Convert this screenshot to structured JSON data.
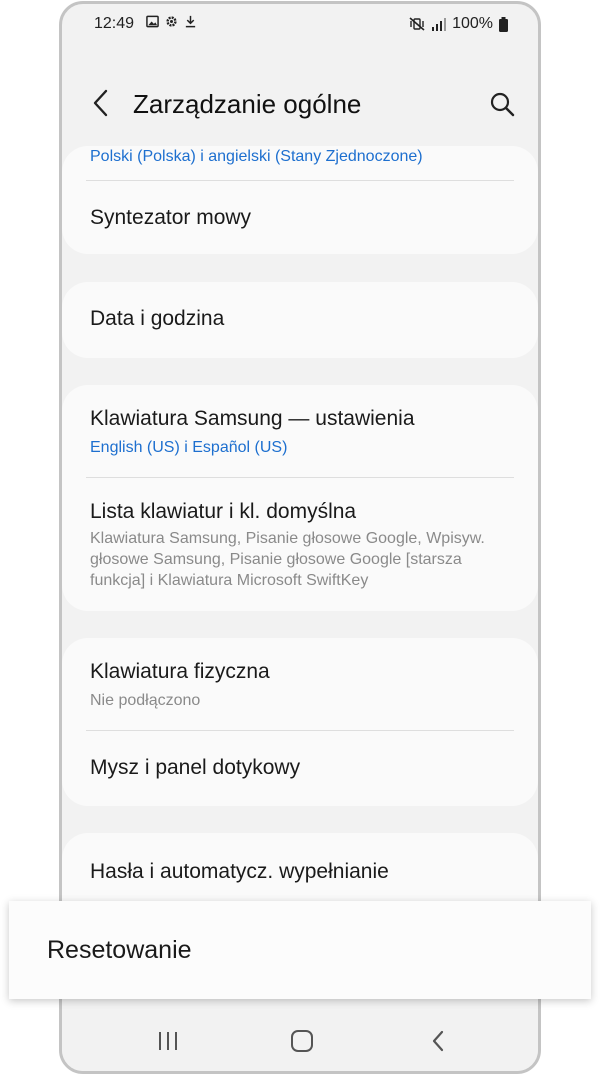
{
  "status": {
    "time": "12:49",
    "battery": "100%"
  },
  "header": {
    "title": "Zarządzanie ogólne"
  },
  "cards": [
    {
      "rows": [
        {
          "subtitle": "Polski (Polska) i angielski (Stany Zjednoczone)"
        },
        {
          "title": "Syntezator mowy"
        }
      ]
    },
    {
      "rows": [
        {
          "title": "Data i godzina"
        }
      ]
    },
    {
      "rows": [
        {
          "title": "Klawiatura Samsung — ustawienia",
          "subtitle": "English (US) i Español (US)"
        },
        {
          "title": "Lista klawiatur i kl. domyślna",
          "subtitle": "Klawiatura Samsung, Pisanie głosowe Google, Wpisyw. głosowe Samsung, Pisanie głosowe Google [starsza funkcja] i Klawiatura Microsoft SwiftKey"
        }
      ]
    },
    {
      "rows": [
        {
          "title": "Klawiatura fizyczna",
          "subtitle": "Nie podłączono"
        },
        {
          "title": "Mysz i panel dotykowy"
        }
      ]
    },
    {
      "rows": [
        {
          "title": "Hasła i automatycz. wypełnianie"
        }
      ]
    }
  ],
  "highlight": {
    "label": "Resetowanie"
  },
  "colors": {
    "link_blue": "#1d6fcf",
    "background": "#f2f2f2",
    "card": "#fafafa"
  },
  "icons": [
    "image-icon",
    "gear-icon",
    "download-icon",
    "vibrate-mute-icon",
    "signal-icon",
    "battery-icon",
    "back-arrow-icon",
    "search-icon",
    "recents-icon",
    "home-icon",
    "nav-back-icon"
  ]
}
